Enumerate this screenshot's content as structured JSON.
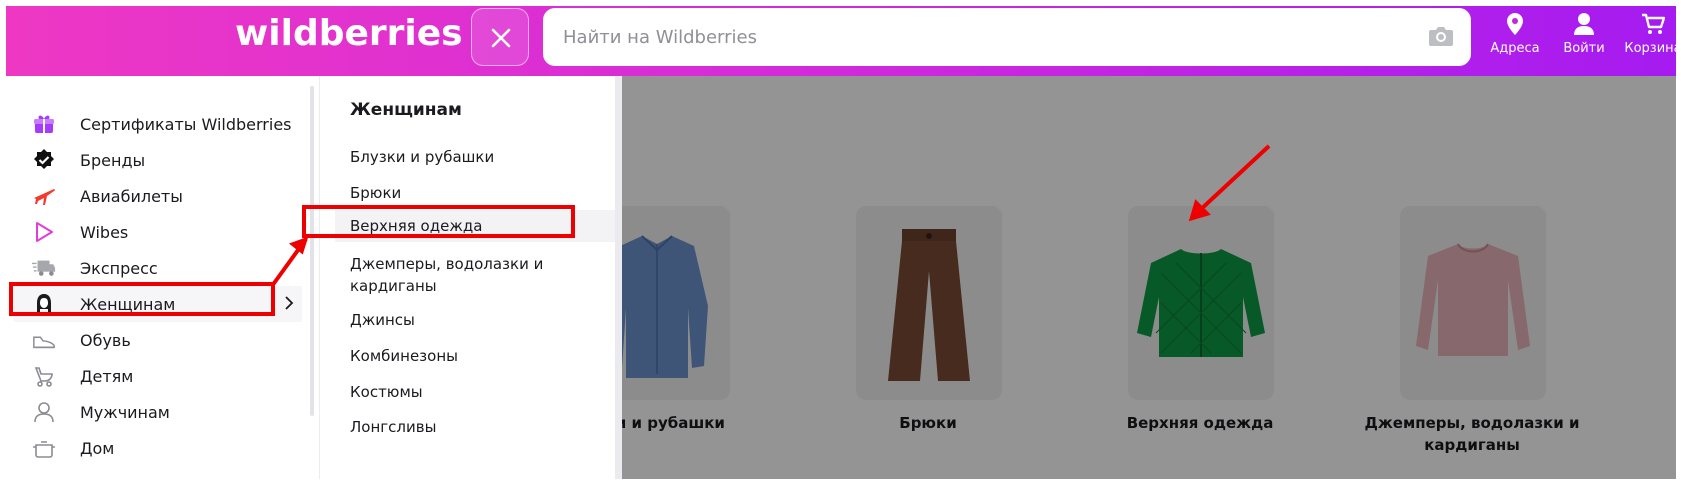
{
  "header": {
    "logo": "wildberries",
    "search_placeholder": "Найти на Wildberries",
    "buttons": [
      {
        "label": "Адреса",
        "icon": "location-pin-icon"
      },
      {
        "label": "Войти",
        "icon": "user-icon"
      },
      {
        "label": "Корзина",
        "icon": "cart-icon"
      }
    ]
  },
  "sidebar": {
    "items": [
      {
        "label": "Сертификаты Wildberries",
        "icon": "gift-icon"
      },
      {
        "label": "Бренды",
        "icon": "verified-badge-icon"
      },
      {
        "label": "Авиабилеты",
        "icon": "airplane-icon"
      },
      {
        "label": "Wibes",
        "icon": "play-icon"
      },
      {
        "label": "Экспресс",
        "icon": "truck-icon"
      },
      {
        "label": "Женщинам",
        "icon": "woman-icon",
        "active": true
      },
      {
        "label": "Обувь",
        "icon": "shoe-icon"
      },
      {
        "label": "Детям",
        "icon": "stroller-icon"
      },
      {
        "label": "Мужчинам",
        "icon": "man-icon"
      },
      {
        "label": "Дом",
        "icon": "pot-icon"
      }
    ]
  },
  "submenu": {
    "title": "Женщинам",
    "items": [
      "Блузки и рубашки",
      "Брюки",
      "Верхняя одежда",
      "Джемперы, водолазки и кардиганы",
      "Джинсы",
      "Комбинезоны",
      "Костюмы",
      "Лонгсливы"
    ]
  },
  "content": {
    "cards": [
      {
        "caption": "узки и рубашки",
        "image": "blue-shirt"
      },
      {
        "caption": "Брюки",
        "image": "brown-trousers"
      },
      {
        "caption": "Верхняя одежда",
        "image": "green-quilted-jacket"
      },
      {
        "caption": "Джемперы, водолазки и кардиганы",
        "image": "pink-sweatshirt"
      }
    ]
  },
  "colors": {
    "header_gradient_start": "#ee38c4",
    "header_gradient_end": "#a51bf0",
    "annotation_red": "#ee0000"
  }
}
